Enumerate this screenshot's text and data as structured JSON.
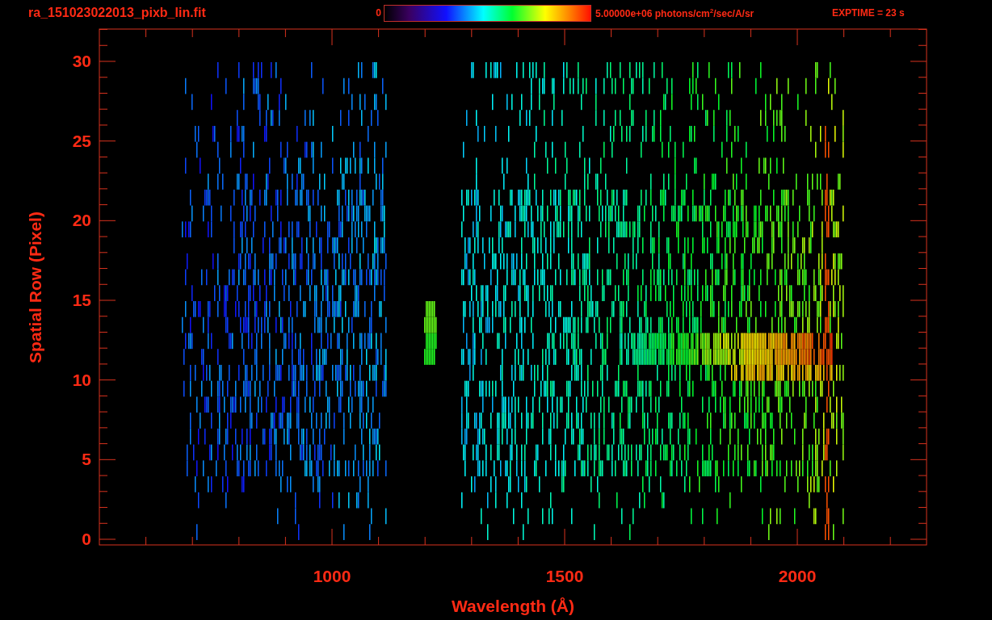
{
  "title": "ra_151023022013_pixb_lin.fit",
  "color_scale": {
    "min_label": "0",
    "max_label": "5.00000e+06 photons/cm$^{2}$/sec/A/sr"
  },
  "exposure": "EXPTIME = 23 s",
  "y_axis": {
    "label": "Spatial Row (Pixel)",
    "ticks": [
      "30",
      "25",
      "20",
      "15",
      "10",
      "5",
      "0"
    ]
  },
  "x_axis": {
    "label": "Wavelength (Å)",
    "ticks": [
      "1000",
      "1500",
      "2000"
    ]
  }
}
